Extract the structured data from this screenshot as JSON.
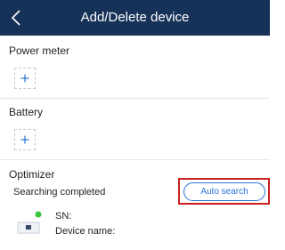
{
  "header": {
    "title": "Add/Delete device"
  },
  "sections": {
    "power_meter": {
      "title": "Power meter"
    },
    "battery": {
      "title": "Battery"
    },
    "optimizer": {
      "title": "Optimizer",
      "status": "Searching completed",
      "auto_search_label": "Auto search",
      "device": {
        "sn_label": "SN:",
        "name_label": "Device name:",
        "online_status_color": "#3cc43c"
      }
    }
  },
  "colors": {
    "header_bg": "#173258",
    "accent": "#2a73d6",
    "highlight": "#cc1f1f"
  }
}
